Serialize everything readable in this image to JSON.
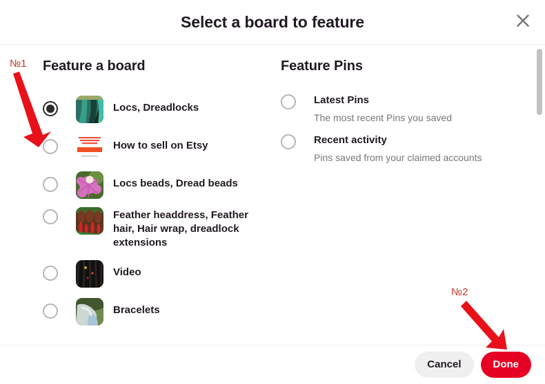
{
  "header": {
    "title": "Select a board to feature",
    "close_icon": "close-icon"
  },
  "boards_section": {
    "title": "Feature a board",
    "items": [
      {
        "label": "Locs, Dreadlocks",
        "selected": true,
        "thumb": "teal-dreadlocks-hair"
      },
      {
        "label": "How to sell on Etsy",
        "selected": false,
        "thumb": "etsy-store-text-pin"
      },
      {
        "label": "Locs beads, Dread beads",
        "selected": false,
        "thumb": "pink-flower-bead"
      },
      {
        "label": "Feather headdress, Feather hair, Hair wrap, dreadlock extensions",
        "selected": false,
        "thumb": "red-feathers"
      },
      {
        "label": "Video",
        "selected": false,
        "thumb": "dark-dreadlocks"
      },
      {
        "label": "Bracelets",
        "selected": false,
        "thumb": "bracelet-hands"
      }
    ]
  },
  "pins_section": {
    "title": "Feature Pins",
    "items": [
      {
        "label": "Latest Pins",
        "description": "The most recent Pins you saved",
        "selected": false
      },
      {
        "label": "Recent activity",
        "description": "Pins saved from your claimed accounts",
        "selected": false
      }
    ]
  },
  "footer": {
    "cancel_label": "Cancel",
    "done_label": "Done"
  },
  "annotations": [
    {
      "id": 1,
      "label": "№1",
      "target": "first-board-radio"
    },
    {
      "id": 2,
      "label": "№2",
      "target": "done-button"
    }
  ],
  "colors": {
    "brand_red": "#e60023",
    "annotation_red": "#e8111a",
    "annotation_label": "#c0392b",
    "text_primary": "#211922",
    "text_secondary": "#767676",
    "cancel_bg": "#efefef",
    "divider": "#eeeeee",
    "scrollbar_thumb": "#c1c1c1"
  }
}
